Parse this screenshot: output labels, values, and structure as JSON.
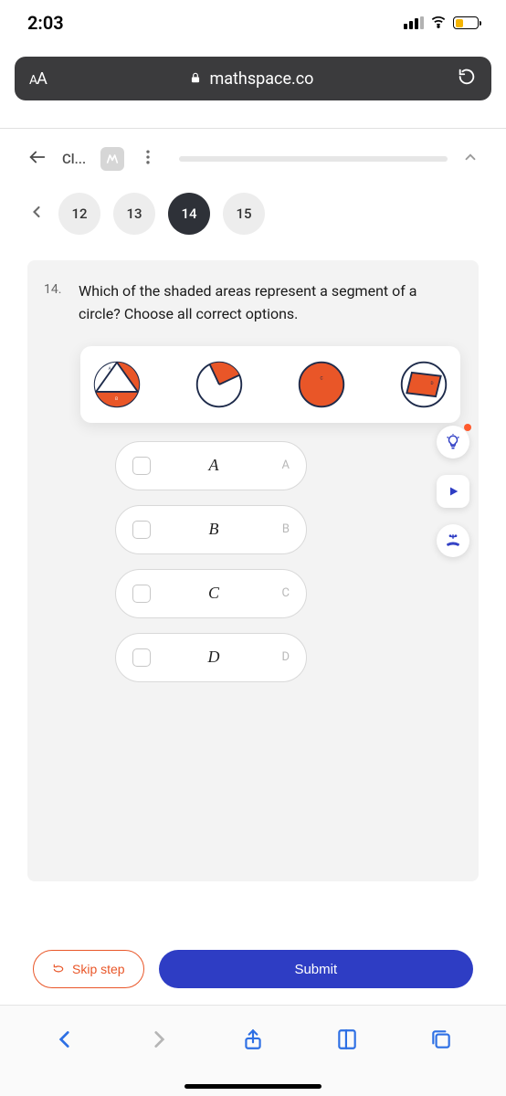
{
  "status": {
    "time": "2:03"
  },
  "url_bar": {
    "aa": "AA",
    "domain": "mathspace.co"
  },
  "app_bar": {
    "breadcrumb": "Cl..."
  },
  "nav": {
    "items": [
      {
        "n": "12"
      },
      {
        "n": "13"
      },
      {
        "n": "14"
      },
      {
        "n": "15"
      }
    ]
  },
  "question": {
    "number": "14.",
    "text": "Which of the shaded areas represent a segment of a circle? Choose all correct options."
  },
  "options": [
    {
      "label": "A",
      "tag": "A"
    },
    {
      "label": "B",
      "tag": "B"
    },
    {
      "label": "C",
      "tag": "C"
    },
    {
      "label": "D",
      "tag": "D"
    }
  ],
  "buttons": {
    "skip": "Skip step",
    "submit": "Submit"
  },
  "diagram_labels": {
    "a": "A",
    "b": "B",
    "c": "C",
    "d": "D"
  }
}
